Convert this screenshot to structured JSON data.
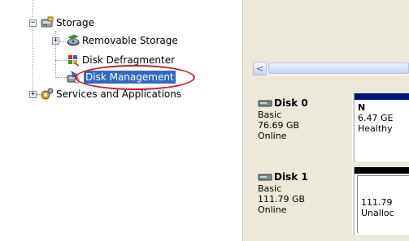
{
  "tree": {
    "storage": {
      "label": "Storage",
      "expander": "−"
    },
    "removable_storage": {
      "label": "Removable Storage",
      "expander": "+"
    },
    "disk_defragmenter": {
      "label": "Disk Defragmenter"
    },
    "disk_management": {
      "label": "Disk Management"
    },
    "services_apps": {
      "label": "Services and Applications",
      "expander": "+"
    }
  },
  "scrollbar": {
    "left_arrow": "<"
  },
  "disks": [
    {
      "name": "Disk 0",
      "type": "Basic",
      "size": "76.69 GB",
      "status": "Online",
      "volume": {
        "label": "N",
        "size": "6.47 GE",
        "status": "Healthy",
        "bar_color": "#00117c"
      }
    },
    {
      "name": "Disk 1",
      "type": "Basic",
      "size": "111.79 GB",
      "status": "Online",
      "volume": {
        "label": "",
        "size": "111.79",
        "status": "Unalloc",
        "bar_color": "#000000"
      }
    }
  ],
  "colors": {
    "selection": "#316ac5",
    "annotation_ring": "#d81c24"
  }
}
